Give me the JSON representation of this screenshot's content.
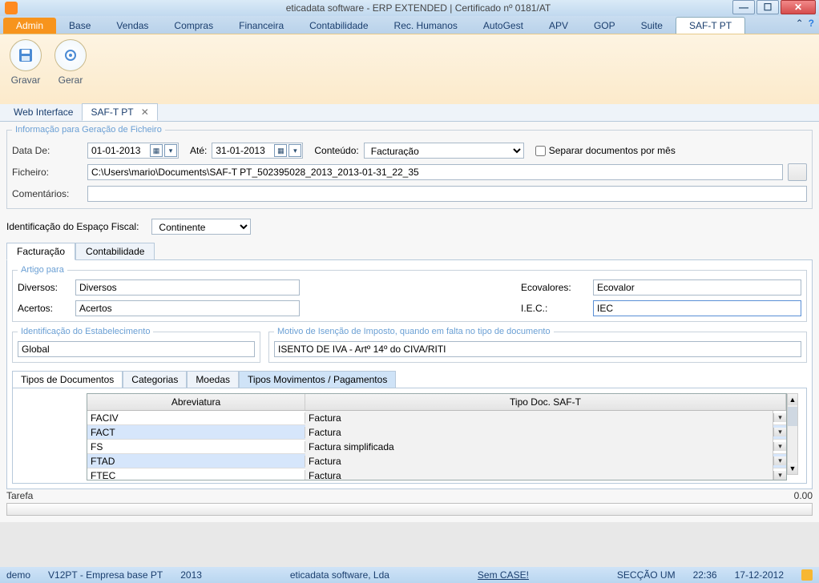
{
  "window": {
    "title": "eticadata software - ERP EXTENDED | Certificado nº 0181/AT"
  },
  "ribbon": {
    "tabs": [
      "Admin",
      "Base",
      "Vendas",
      "Compras",
      "Financeira",
      "Contabilidade",
      "Rec. Humanos",
      "AutoGest",
      "APV",
      "GOP",
      "Suite",
      "SAF-T PT"
    ],
    "active": "SAF-T PT",
    "buttons": {
      "gravar": "Gravar",
      "gerar": "Gerar"
    }
  },
  "doctabs": {
    "web": "Web Interface",
    "saft": "SAF-T PT"
  },
  "group_info_title": "Informação para Geração de Ficheiro",
  "labels": {
    "data_de": "Data De:",
    "ate": "Até:",
    "conteudo": "Conteúdo:",
    "separar": "Separar documentos por mês",
    "ficheiro": "Ficheiro:",
    "comentarios": "Comentários:",
    "fiscal": "Identificação do Espaço Fiscal:",
    "artigo_para": "Artigo para",
    "diversos": "Diversos:",
    "acertos": "Acertos:",
    "ecovalores": "Ecovalores:",
    "iec": "I.E.C.:",
    "id_estab": "Identificação do Estabelecimento",
    "motivo": "Motivo de Isenção de Imposto, quando em falta no tipo de documento",
    "tarefa": "Tarefa",
    "tarefa_val": "0.00"
  },
  "form": {
    "data_de": "01-01-2013",
    "ate": "31-01-2013",
    "conteudo": "Facturação",
    "ficheiro": "C:\\Users\\mario\\Documents\\SAF-T PT_502395028_2013_2013-01-31_22_35",
    "comentarios": "",
    "fiscal": "Continente",
    "diversos": "Diversos",
    "acertos": "Acertos",
    "ecovalores": "Ecovalor",
    "iec": "IEC",
    "global": "Global",
    "isento": "ISENTO DE IVA - Artº 14º do CIVA/RITI"
  },
  "innertabs": {
    "facturacao": "Facturação",
    "contabilidade": "Contabilidade"
  },
  "subtabs": {
    "tipos": "Tipos de Documentos",
    "categorias": "Categorias",
    "moedas": "Moedas",
    "mov": "Tipos Movimentos / Pagamentos"
  },
  "table": {
    "col1": "Abreviatura",
    "col2": "Tipo Doc. SAF-T",
    "rows": [
      {
        "ab": "FACIV",
        "tipo": "Factura",
        "sel": false
      },
      {
        "ab": "FACT",
        "tipo": "Factura",
        "sel": true
      },
      {
        "ab": "FS",
        "tipo": "Factura simplificada",
        "sel": false
      },
      {
        "ab": "FTAD",
        "tipo": "Factura",
        "sel": true
      },
      {
        "ab": "FTEC",
        "tipo": "Factura",
        "sel": false
      }
    ]
  },
  "status": {
    "user": "demo",
    "empresa": "V12PT - Empresa base PT",
    "ano": "2013",
    "company": "eticadata software, Lda",
    "case": "Sem CASE!",
    "seccao": "SECÇÃO UM",
    "time": "22:36",
    "date": "17-12-2012"
  }
}
